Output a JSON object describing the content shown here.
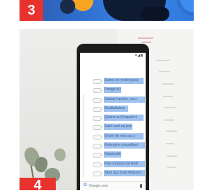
{
  "tiles": {
    "top": {
      "number": "3"
    },
    "bottom": {
      "number": "4"
    }
  },
  "phone": {
    "status_icons": "▾◢▮",
    "search_bar": {
      "brand": "G",
      "label": "Google.com"
    },
    "list_items": [
      "Autres en mode placé",
      "Potage du Roi",
      "Salade hachée, mou",
      "Bouillabaisse",
      "Quiche au Roquefort",
      "Saint curé au jour",
      "Gratin de veau au s",
      "Aubergine croustillant",
      "Ratatouille",
      "Pain d'épices de Noël",
      "Tarte aux fruits Maisons"
    ]
  },
  "colors": {
    "badge": "#e8322d",
    "highlight": "#9ec1ee",
    "banner_blue": "#2f6fd0"
  }
}
